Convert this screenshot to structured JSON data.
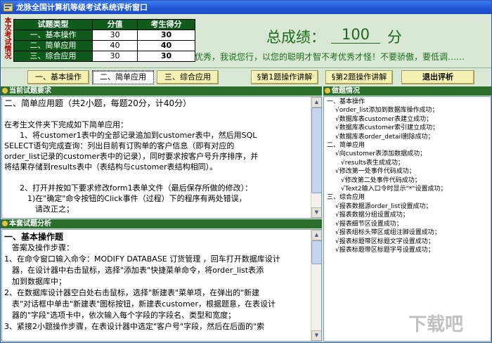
{
  "window": {
    "title": "龙脉全国计算机等级考试系统评析窗口"
  },
  "summary": {
    "vertical_label": "本次考试情况",
    "columns": [
      "试题类型",
      "分值",
      "考生得分"
    ],
    "rows": [
      {
        "type": "一、基本操作",
        "value": "30",
        "score": "30"
      },
      {
        "type": "二、简单应用",
        "value": "40",
        "score": "40"
      },
      {
        "type": "三、综合应用",
        "value": "30",
        "score": "30"
      }
    ],
    "total_label": "总成绩：",
    "total_value": "100",
    "total_unit": "分",
    "comment": "优秀，我说您行，以您的聪明才智不考优秀才怪！不要骄傲，要低调……"
  },
  "buttons": {
    "basic": "一、基本操作",
    "simple": "二、简单应用",
    "comprehensive": "三、综合应用",
    "q1": "§第1题操作讲解",
    "q2": "§第2题操作讲解",
    "exit": "退出评析"
  },
  "panels": {
    "requirements_header": "当前试题要求",
    "analysis_header": "本套试题分析",
    "status_header": "做题情况"
  },
  "requirements": {
    "lines": [
      "二、简单应用题（共2小题，每题20分，计40分）",
      "",
      "在考生文件夹下完成如下简单应用：",
      "　　1、将customer1表中的全部记录追加到customer表中，然后用SQL",
      "SELECT语句完成查询：列出目前有订购单的客户信息（即有对应的",
      "order_list记录的customer表中的记录），同时要求按客户号升序排序，并",
      "将结果存储到results表中（表结构与customer表结构相同）。",
      "",
      "　　2、打开并按如下要求修改form1表单文件（最后保存所做的修改）：",
      "　　　1)在\"确定\"命令按钮的Click事件（过程）下的程序有两处错误，",
      "　　　　请改正之；"
    ]
  },
  "analysis": {
    "title": "一、基本操作题",
    "subtitle": "　答案及操作步骤：",
    "lines": [
      "1、在命令窗口输入命令：MODIFY DATABASE 订货管理 ，回车打开数据库设计",
      "　器，在设计器中右击鼠标，选择\"添加表\"快捷菜单命令，将order_list表添",
      "　加到数据库中；",
      "2、在数据库设计器空白处右击鼠标，选择\"新建表\"菜单项，在弹出的\"新建",
      "　表\"对话框中单击\"新建表\"图标按钮，新建表customer，根据题意，在表设计",
      "　器的\"字段\"选项卡中，依次输入每个字段的字段名、类型和宽度；",
      "3、紧接2小题操作步骤，在表设计器中选定\"客户号\"字段，然后在后面的\"索"
    ]
  },
  "status_tree": [
    {
      "level": 0,
      "text": "一、基本操作"
    },
    {
      "level": 1,
      "text": "√order_list添加到数据库操作成功；"
    },
    {
      "level": 1,
      "text": "√数据库表customer表建立成功；"
    },
    {
      "level": 1,
      "text": "√数据库表customer索引建立成功；"
    },
    {
      "level": 1,
      "text": "√数据库表order_detail删除成功；"
    },
    {
      "level": 0,
      "text": "二、简单应用"
    },
    {
      "level": 1,
      "text": "√向customer表添加数据成功；"
    },
    {
      "level": 2,
      "text": "√results表生成成功；"
    },
    {
      "level": 1,
      "text": "√修改第一处事件代码成功；"
    },
    {
      "level": 2,
      "text": "√修改第二处事件代码成功；"
    },
    {
      "level": 2,
      "text": "√Text2输入口令时显示\"*\"设置成功；"
    },
    {
      "level": 0,
      "text": "三、综合应用"
    },
    {
      "level": 1,
      "text": "√报表数据源order_list设置成功；"
    },
    {
      "level": 1,
      "text": "√报表数据分组设置成功；"
    },
    {
      "level": 1,
      "text": "√报表细节区设置成功；"
    },
    {
      "level": 1,
      "text": "√报表组标头带区或组注脚设置成功；"
    },
    {
      "level": 1,
      "text": "√报表标题带区标题文字设置成功；"
    },
    {
      "level": 1,
      "text": "√报表标题带区标题字号设置成功；"
    }
  ],
  "watermark": "下载吧",
  "colors": {
    "title_bar": "#1f56d6",
    "table_header": "#0e5b1c",
    "button": "#f5f1b3",
    "panel_header": "#2c6e2c",
    "score_text": "#1a6a1a"
  }
}
